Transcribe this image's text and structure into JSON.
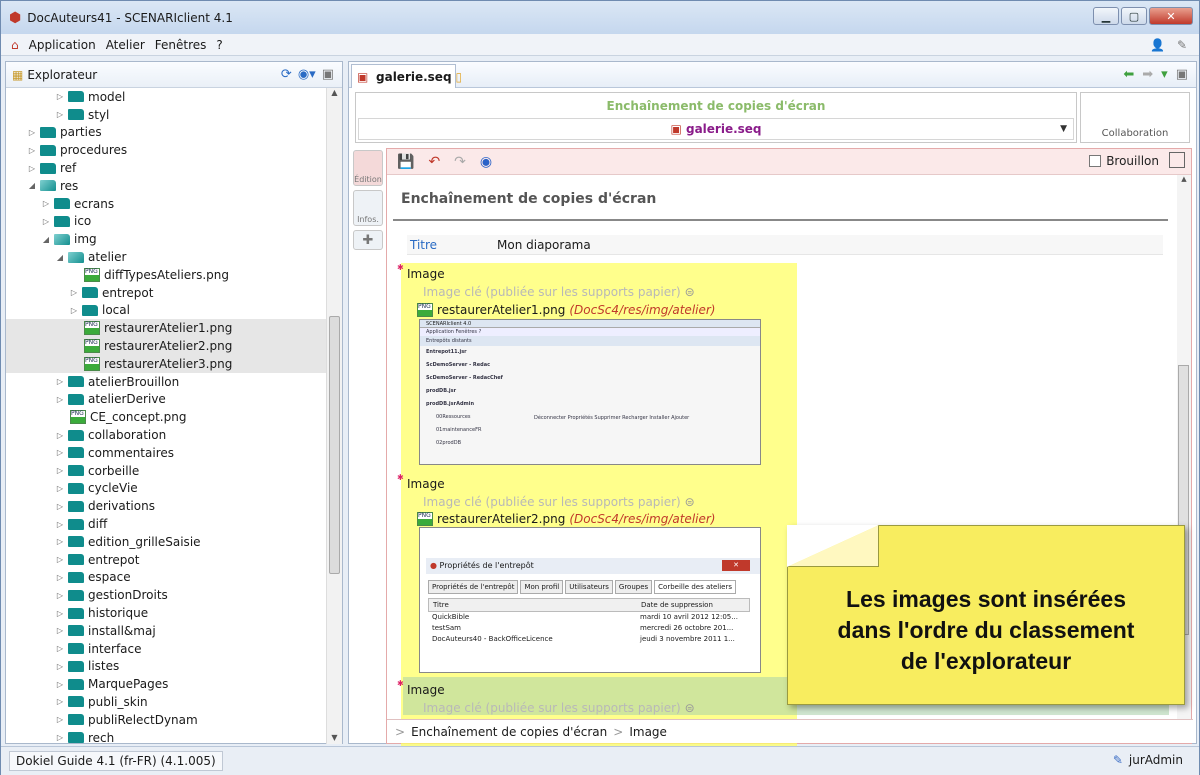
{
  "window": {
    "title": "DocAuteurs41 - SCENARIclient 4.1"
  },
  "menu": [
    "Application",
    "Atelier",
    "Fenêtres",
    "?"
  ],
  "explorer": {
    "title": "Explorateur",
    "items": [
      {
        "label": "model",
        "depth": 2,
        "kind": "folder",
        "arrow": "▷"
      },
      {
        "label": "styl",
        "depth": 2,
        "kind": "folder",
        "arrow": "▷"
      },
      {
        "label": "parties",
        "depth": 0,
        "kind": "folder",
        "arrow": "▷"
      },
      {
        "label": "procedures",
        "depth": 0,
        "kind": "folder",
        "arrow": "▷"
      },
      {
        "label": "ref",
        "depth": 0,
        "kind": "folder",
        "arrow": "▷"
      },
      {
        "label": "res",
        "depth": 0,
        "kind": "open",
        "arrow": "◢"
      },
      {
        "label": "ecrans",
        "depth": 1,
        "kind": "folder",
        "arrow": "▷"
      },
      {
        "label": "ico",
        "depth": 1,
        "kind": "folder",
        "arrow": "▷"
      },
      {
        "label": "img",
        "depth": 1,
        "kind": "open",
        "arrow": "◢"
      },
      {
        "label": "atelier",
        "depth": 2,
        "kind": "open",
        "arrow": "◢"
      },
      {
        "label": "diffTypesAteliers.png",
        "depth": 3,
        "kind": "png",
        "arrow": ""
      },
      {
        "label": "entrepot",
        "depth": 3,
        "kind": "folder",
        "arrow": "▷"
      },
      {
        "label": "local",
        "depth": 3,
        "kind": "folder",
        "arrow": "▷"
      },
      {
        "label": "restaurerAtelier1.png",
        "depth": 3,
        "kind": "png",
        "arrow": "",
        "selected": true
      },
      {
        "label": "restaurerAtelier2.png",
        "depth": 3,
        "kind": "png",
        "arrow": "",
        "selected": true
      },
      {
        "label": "restaurerAtelier3.png",
        "depth": 3,
        "kind": "png",
        "arrow": "",
        "selected": true
      },
      {
        "label": "atelierBrouillon",
        "depth": 2,
        "kind": "folder",
        "arrow": "▷"
      },
      {
        "label": "atelierDerive",
        "depth": 2,
        "kind": "folder",
        "arrow": "▷"
      },
      {
        "label": "CE_concept.png",
        "depth": 2,
        "kind": "png",
        "arrow": ""
      },
      {
        "label": "collaboration",
        "depth": 2,
        "kind": "folder",
        "arrow": "▷"
      },
      {
        "label": "commentaires",
        "depth": 2,
        "kind": "folder",
        "arrow": "▷"
      },
      {
        "label": "corbeille",
        "depth": 2,
        "kind": "folder",
        "arrow": "▷"
      },
      {
        "label": "cycleVie",
        "depth": 2,
        "kind": "folder",
        "arrow": "▷"
      },
      {
        "label": "derivations",
        "depth": 2,
        "kind": "folder",
        "arrow": "▷"
      },
      {
        "label": "diff",
        "depth": 2,
        "kind": "folder",
        "arrow": "▷"
      },
      {
        "label": "edition_grilleSaisie",
        "depth": 2,
        "kind": "folder",
        "arrow": "▷"
      },
      {
        "label": "entrepot",
        "depth": 2,
        "kind": "folder",
        "arrow": "▷"
      },
      {
        "label": "espace",
        "depth": 2,
        "kind": "folder",
        "arrow": "▷"
      },
      {
        "label": "gestionDroits",
        "depth": 2,
        "kind": "folder",
        "arrow": "▷"
      },
      {
        "label": "historique",
        "depth": 2,
        "kind": "folder",
        "arrow": "▷"
      },
      {
        "label": "install&maj",
        "depth": 2,
        "kind": "folder",
        "arrow": "▷"
      },
      {
        "label": "interface",
        "depth": 2,
        "kind": "folder",
        "arrow": "▷"
      },
      {
        "label": "listes",
        "depth": 2,
        "kind": "folder",
        "arrow": "▷"
      },
      {
        "label": "MarquePages",
        "depth": 2,
        "kind": "folder",
        "arrow": "▷"
      },
      {
        "label": "publi_skin",
        "depth": 2,
        "kind": "folder",
        "arrow": "▷"
      },
      {
        "label": "publiRelectDynam",
        "depth": 2,
        "kind": "folder",
        "arrow": "▷"
      },
      {
        "label": "rech",
        "depth": 2,
        "kind": "folder",
        "arrow": "▷"
      }
    ]
  },
  "editor": {
    "tab_label": "galerie.seq",
    "model_title": "Enchaînement de copies d'écran",
    "file_select": "galerie.seq",
    "collaboration": "Collaboration",
    "side_tabs": {
      "edition": "Édition",
      "infos": "Infos."
    },
    "brouillon": "Brouillon",
    "doc_title": "Enchaînement de copies d'écran",
    "field_label": "Titre",
    "field_value": "Mon diaporama",
    "image_label": "Image",
    "key_image_placeholder": "Image clé (publiée sur les supports papier)",
    "image1": {
      "name": "restaurerAtelier1.png",
      "path": "(DocSc4/res/img/atelier)"
    },
    "image2": {
      "name": "restaurerAtelier2.png",
      "path": "(DocSc4/res/img/atelier)"
    },
    "breadcrumb": [
      "Enchaînement de copies d'écran",
      "Image"
    ]
  },
  "thumb1": {
    "app": "SCENARIclient 4.0",
    "menu": "Application   Fenêtres   ?",
    "panel": "Entrepôts distants",
    "rows": [
      "Entrepot11.jsr",
      "ScDemoServer - Redac",
      "ScDemoServer - RedacChef",
      "prodDB.jsr",
      "prodDB.jsrAdmin",
      "00Ressources",
      "01maintenanceFR",
      "02prodDB"
    ],
    "actions": "Déconnecter   Propriétés   Supprimer   Recharger   Installer   Ajouter"
  },
  "thumb2": {
    "title": "Propriétés de l'entrepôt",
    "tabs": [
      "Propriétés de l'entrepôt",
      "Mon profil",
      "Utilisateurs",
      "Groupes",
      "Corbeille des ateliers"
    ],
    "col1": "Titre",
    "col2": "Date de suppression",
    "rows": [
      [
        "QuickBible",
        "mardi 10 avril 2012 12:05..."
      ],
      [
        "testSam",
        "mercredi 26 octobre 201..."
      ],
      [
        "DocAuteurs40 - BackOfficeLicence",
        "jeudi 3 novembre 2011 1..."
      ]
    ]
  },
  "note": "Les images sont insérées dans l'ordre du classement de l'explorateur",
  "status": {
    "left": "Dokiel Guide 4.1 (fr-FR) (4.1.005)",
    "user": "jurAdmin"
  }
}
